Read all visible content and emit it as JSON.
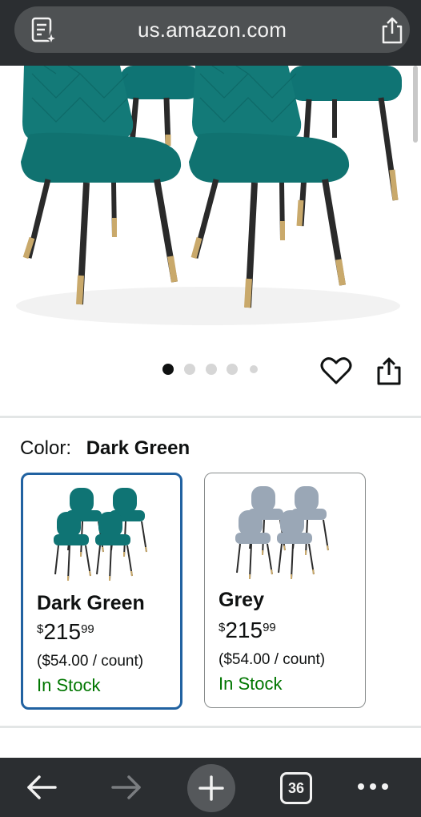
{
  "browser": {
    "url": "us.amazon.com",
    "page_tools_icon": "page-sparkle-icon",
    "share_icon": "share-icon"
  },
  "gallery": {
    "image_count": 5,
    "active_index": 0
  },
  "product": {
    "color_label": "Color:",
    "selected_color": "Dark Green",
    "variants": [
      {
        "name": "Dark Green",
        "price_symbol": "$",
        "price_whole": "215",
        "price_fraction": "99",
        "unit_price": "($54.00 / count)",
        "availability": "In Stock",
        "chair_color": "#0f7474",
        "selected": true
      },
      {
        "name": "Grey",
        "price_symbol": "$",
        "price_whole": "215",
        "price_fraction": "99",
        "unit_price": "($54.00 / count)",
        "availability": "In Stock",
        "chair_color": "#9aa7b6",
        "selected": false
      }
    ]
  },
  "toolbar": {
    "tab_count": "36"
  },
  "colors": {
    "selected_border": "#2162a1",
    "in_stock": "#007600",
    "bar_background": "#2b2e31"
  }
}
